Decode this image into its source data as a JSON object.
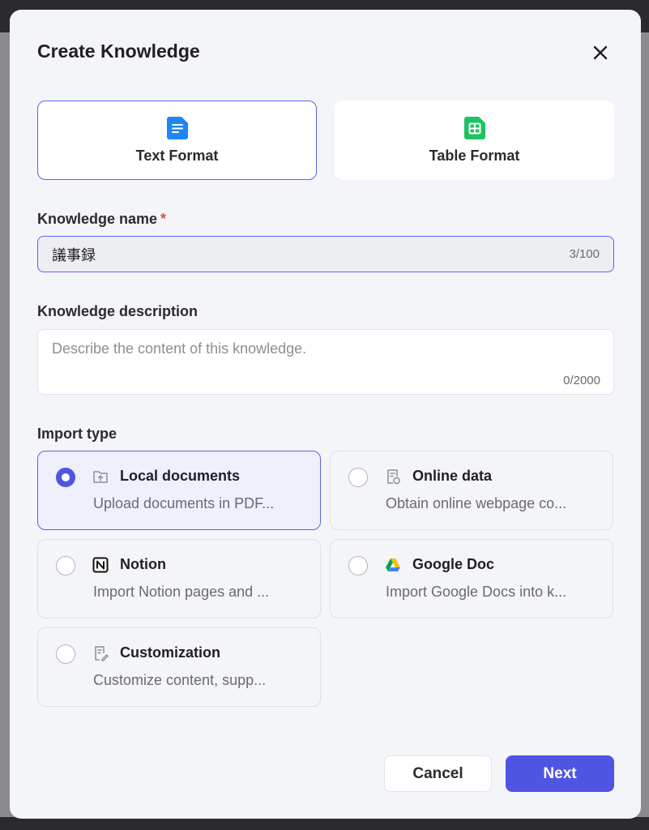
{
  "dialog": {
    "title": "Create Knowledge",
    "close_icon": "close-icon"
  },
  "format": {
    "options": [
      {
        "label": "Text Format",
        "icon": "document-icon",
        "color": "#1f86f5",
        "selected": true
      },
      {
        "label": "Table Format",
        "icon": "table-icon",
        "color": "#1fc264",
        "selected": false
      }
    ]
  },
  "name_field": {
    "label": "Knowledge name",
    "required_mark": "*",
    "value": "議事録",
    "counter": "3/100"
  },
  "description_field": {
    "label": "Knowledge description",
    "placeholder": "Describe the content of this knowledge.",
    "value": "",
    "counter": "0/2000"
  },
  "import_type": {
    "label": "Import type",
    "options": [
      {
        "title": "Local documents",
        "description": "Upload documents in PDF...",
        "icon": "folder-upload-icon",
        "selected": true
      },
      {
        "title": "Online data",
        "description": "Obtain online webpage co...",
        "icon": "web-document-icon",
        "selected": false
      },
      {
        "title": "Notion",
        "description": "Import Notion pages and ...",
        "icon": "notion-icon",
        "selected": false
      },
      {
        "title": "Google Doc",
        "description": "Import Google Docs into k...",
        "icon": "google-drive-icon",
        "selected": false
      },
      {
        "title": "Customization",
        "description": "Customize content, supp...",
        "icon": "edit-document-icon",
        "selected": false
      }
    ]
  },
  "actions": {
    "cancel": "Cancel",
    "next": "Next"
  },
  "colors": {
    "accent": "#4f55e3",
    "required": "#e5484d"
  }
}
